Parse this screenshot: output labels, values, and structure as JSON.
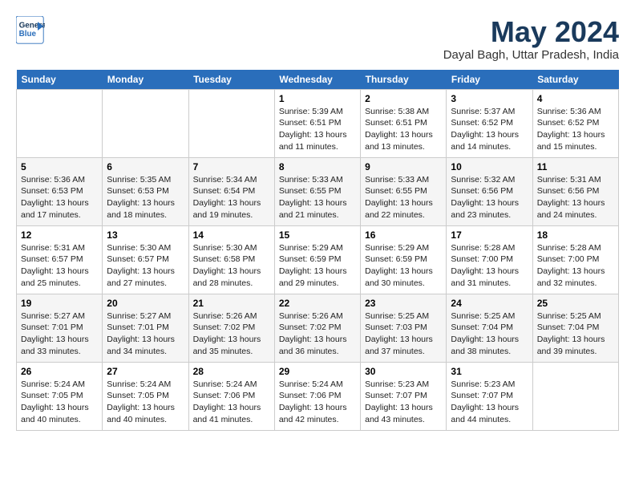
{
  "header": {
    "logo_line1": "General",
    "logo_line2": "Blue",
    "title": "May 2024",
    "subtitle": "Dayal Bagh, Uttar Pradesh, India"
  },
  "days_of_week": [
    "Sunday",
    "Monday",
    "Tuesday",
    "Wednesday",
    "Thursday",
    "Friday",
    "Saturday"
  ],
  "weeks": [
    [
      {
        "day": "",
        "sunrise": "",
        "sunset": "",
        "daylight": ""
      },
      {
        "day": "",
        "sunrise": "",
        "sunset": "",
        "daylight": ""
      },
      {
        "day": "",
        "sunrise": "",
        "sunset": "",
        "daylight": ""
      },
      {
        "day": "1",
        "sunrise": "Sunrise: 5:39 AM",
        "sunset": "Sunset: 6:51 PM",
        "daylight": "Daylight: 13 hours and 11 minutes."
      },
      {
        "day": "2",
        "sunrise": "Sunrise: 5:38 AM",
        "sunset": "Sunset: 6:51 PM",
        "daylight": "Daylight: 13 hours and 13 minutes."
      },
      {
        "day": "3",
        "sunrise": "Sunrise: 5:37 AM",
        "sunset": "Sunset: 6:52 PM",
        "daylight": "Daylight: 13 hours and 14 minutes."
      },
      {
        "day": "4",
        "sunrise": "Sunrise: 5:36 AM",
        "sunset": "Sunset: 6:52 PM",
        "daylight": "Daylight: 13 hours and 15 minutes."
      }
    ],
    [
      {
        "day": "5",
        "sunrise": "Sunrise: 5:36 AM",
        "sunset": "Sunset: 6:53 PM",
        "daylight": "Daylight: 13 hours and 17 minutes."
      },
      {
        "day": "6",
        "sunrise": "Sunrise: 5:35 AM",
        "sunset": "Sunset: 6:53 PM",
        "daylight": "Daylight: 13 hours and 18 minutes."
      },
      {
        "day": "7",
        "sunrise": "Sunrise: 5:34 AM",
        "sunset": "Sunset: 6:54 PM",
        "daylight": "Daylight: 13 hours and 19 minutes."
      },
      {
        "day": "8",
        "sunrise": "Sunrise: 5:33 AM",
        "sunset": "Sunset: 6:55 PM",
        "daylight": "Daylight: 13 hours and 21 minutes."
      },
      {
        "day": "9",
        "sunrise": "Sunrise: 5:33 AM",
        "sunset": "Sunset: 6:55 PM",
        "daylight": "Daylight: 13 hours and 22 minutes."
      },
      {
        "day": "10",
        "sunrise": "Sunrise: 5:32 AM",
        "sunset": "Sunset: 6:56 PM",
        "daylight": "Daylight: 13 hours and 23 minutes."
      },
      {
        "day": "11",
        "sunrise": "Sunrise: 5:31 AM",
        "sunset": "Sunset: 6:56 PM",
        "daylight": "Daylight: 13 hours and 24 minutes."
      }
    ],
    [
      {
        "day": "12",
        "sunrise": "Sunrise: 5:31 AM",
        "sunset": "Sunset: 6:57 PM",
        "daylight": "Daylight: 13 hours and 25 minutes."
      },
      {
        "day": "13",
        "sunrise": "Sunrise: 5:30 AM",
        "sunset": "Sunset: 6:57 PM",
        "daylight": "Daylight: 13 hours and 27 minutes."
      },
      {
        "day": "14",
        "sunrise": "Sunrise: 5:30 AM",
        "sunset": "Sunset: 6:58 PM",
        "daylight": "Daylight: 13 hours and 28 minutes."
      },
      {
        "day": "15",
        "sunrise": "Sunrise: 5:29 AM",
        "sunset": "Sunset: 6:59 PM",
        "daylight": "Daylight: 13 hours and 29 minutes."
      },
      {
        "day": "16",
        "sunrise": "Sunrise: 5:29 AM",
        "sunset": "Sunset: 6:59 PM",
        "daylight": "Daylight: 13 hours and 30 minutes."
      },
      {
        "day": "17",
        "sunrise": "Sunrise: 5:28 AM",
        "sunset": "Sunset: 7:00 PM",
        "daylight": "Daylight: 13 hours and 31 minutes."
      },
      {
        "day": "18",
        "sunrise": "Sunrise: 5:28 AM",
        "sunset": "Sunset: 7:00 PM",
        "daylight": "Daylight: 13 hours and 32 minutes."
      }
    ],
    [
      {
        "day": "19",
        "sunrise": "Sunrise: 5:27 AM",
        "sunset": "Sunset: 7:01 PM",
        "daylight": "Daylight: 13 hours and 33 minutes."
      },
      {
        "day": "20",
        "sunrise": "Sunrise: 5:27 AM",
        "sunset": "Sunset: 7:01 PM",
        "daylight": "Daylight: 13 hours and 34 minutes."
      },
      {
        "day": "21",
        "sunrise": "Sunrise: 5:26 AM",
        "sunset": "Sunset: 7:02 PM",
        "daylight": "Daylight: 13 hours and 35 minutes."
      },
      {
        "day": "22",
        "sunrise": "Sunrise: 5:26 AM",
        "sunset": "Sunset: 7:02 PM",
        "daylight": "Daylight: 13 hours and 36 minutes."
      },
      {
        "day": "23",
        "sunrise": "Sunrise: 5:25 AM",
        "sunset": "Sunset: 7:03 PM",
        "daylight": "Daylight: 13 hours and 37 minutes."
      },
      {
        "day": "24",
        "sunrise": "Sunrise: 5:25 AM",
        "sunset": "Sunset: 7:04 PM",
        "daylight": "Daylight: 13 hours and 38 minutes."
      },
      {
        "day": "25",
        "sunrise": "Sunrise: 5:25 AM",
        "sunset": "Sunset: 7:04 PM",
        "daylight": "Daylight: 13 hours and 39 minutes."
      }
    ],
    [
      {
        "day": "26",
        "sunrise": "Sunrise: 5:24 AM",
        "sunset": "Sunset: 7:05 PM",
        "daylight": "Daylight: 13 hours and 40 minutes."
      },
      {
        "day": "27",
        "sunrise": "Sunrise: 5:24 AM",
        "sunset": "Sunset: 7:05 PM",
        "daylight": "Daylight: 13 hours and 40 minutes."
      },
      {
        "day": "28",
        "sunrise": "Sunrise: 5:24 AM",
        "sunset": "Sunset: 7:06 PM",
        "daylight": "Daylight: 13 hours and 41 minutes."
      },
      {
        "day": "29",
        "sunrise": "Sunrise: 5:24 AM",
        "sunset": "Sunset: 7:06 PM",
        "daylight": "Daylight: 13 hours and 42 minutes."
      },
      {
        "day": "30",
        "sunrise": "Sunrise: 5:23 AM",
        "sunset": "Sunset: 7:07 PM",
        "daylight": "Daylight: 13 hours and 43 minutes."
      },
      {
        "day": "31",
        "sunrise": "Sunrise: 5:23 AM",
        "sunset": "Sunset: 7:07 PM",
        "daylight": "Daylight: 13 hours and 44 minutes."
      },
      {
        "day": "",
        "sunrise": "",
        "sunset": "",
        "daylight": ""
      }
    ]
  ]
}
